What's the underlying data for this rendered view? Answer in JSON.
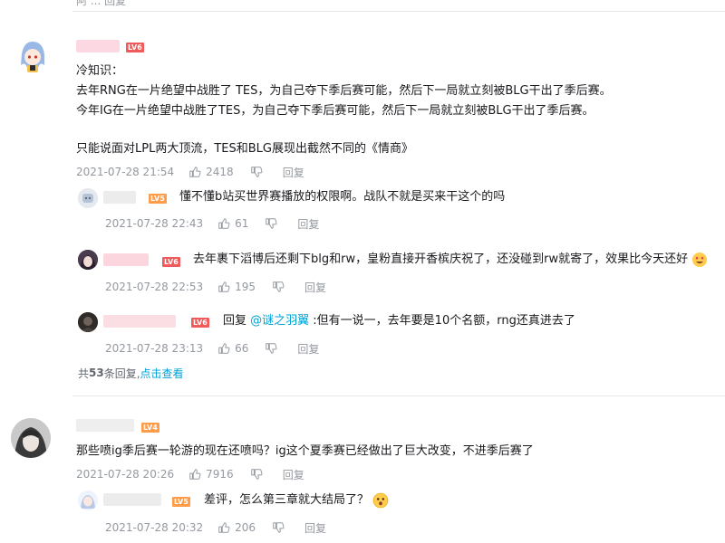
{
  "colors": {
    "accent": "#00a1d6",
    "meta": "#9499a0",
    "level_badge": "#f05a5a",
    "level_badge_orange": "#ff9c4a"
  },
  "top_partial": {
    "name_text": "阿 ... 回复"
  },
  "comment1": {
    "level": "LV6",
    "lines": [
      "冷知识：",
      "去年RNG在一片绝望中战胜了 TES，为自己夺下季后赛可能，然后下一局就立刻被BLG干出了季后赛。",
      "今年IG在一片绝望中战胜了TES，为自己夺下季后赛可能，然后下一局就立刻被BLG干出了季后赛。",
      "",
      "只能说面对LPL两大顶流，TES和BLG展现出截然不同的《情商》"
    ],
    "time": "2021-07-28 21:54",
    "likes": "2418",
    "reply_label": "回复",
    "replies": [
      {
        "level": "LV5",
        "text": "懂不懂b站买世界赛播放的权限啊。战队不就是买来干这个的吗",
        "time": "2021-07-28 22:43",
        "likes": "61",
        "reply_label": "回复"
      },
      {
        "level": "LV6",
        "text": "去年裹下滔博后还剩下blg和rw，皇粉直接开香槟庆祝了，还没碰到rw就寄了，效果比今天还好",
        "time": "2021-07-28 22:53",
        "likes": "195",
        "reply_label": "回复"
      },
      {
        "level": "LV6",
        "prefix": "回复 ",
        "mention": "@谜之羽翼",
        "text": " :但有一说一，去年要是10个名额，rng还真进去了",
        "time": "2021-07-28 23:13",
        "likes": "66",
        "reply_label": "回复"
      }
    ],
    "more_prefix": "共",
    "more_count": "53",
    "more_suffix": "条回复, ",
    "more_link": "点击查看"
  },
  "comment2": {
    "level": "LV4",
    "text": "那些喷ig季后赛一轮游的现在还喷吗？ig这个夏季赛已经做出了巨大改变，不进季后赛了",
    "time": "2021-07-28 20:26",
    "likes": "7916",
    "reply_label": "回复",
    "replies": [
      {
        "level": "LV5",
        "text": "差评，怎么第三章就大结局了？",
        "time": "2021-07-28 20:32",
        "likes": "206",
        "reply_label": "回复"
      }
    ]
  }
}
